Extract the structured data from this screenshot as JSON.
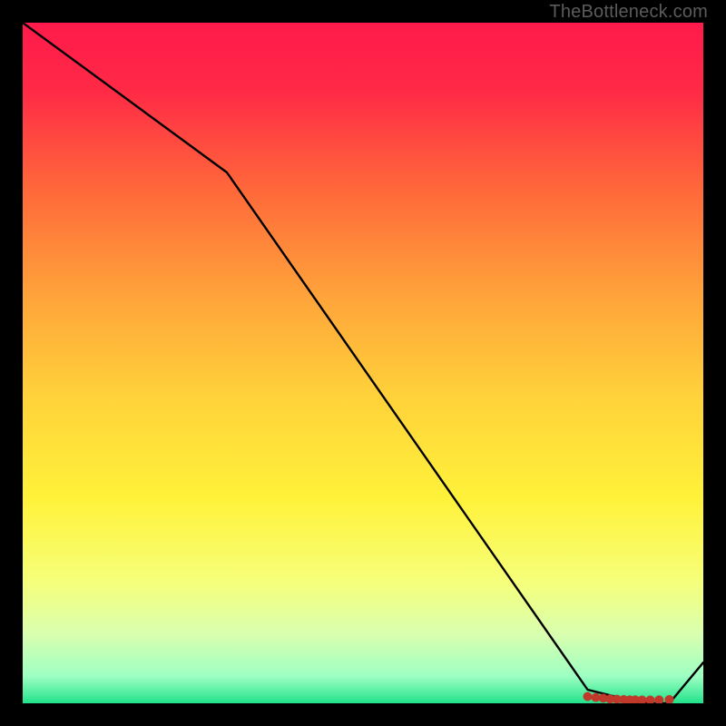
{
  "watermark": "TheBottleneck.com",
  "chart_data": {
    "type": "line",
    "title": "",
    "xlabel": "",
    "ylabel": "",
    "xlim": [
      0,
      100
    ],
    "ylim": [
      0,
      100
    ],
    "grid": false,
    "legend": false,
    "annotations": [],
    "gradient_stops": [
      {
        "offset": 0.0,
        "color": "#ff1a4b"
      },
      {
        "offset": 0.1,
        "color": "#ff2a46"
      },
      {
        "offset": 0.25,
        "color": "#ff6a3a"
      },
      {
        "offset": 0.4,
        "color": "#ffa33a"
      },
      {
        "offset": 0.55,
        "color": "#ffd23a"
      },
      {
        "offset": 0.7,
        "color": "#fff23a"
      },
      {
        "offset": 0.82,
        "color": "#f6ff7a"
      },
      {
        "offset": 0.9,
        "color": "#d8ffb0"
      },
      {
        "offset": 0.96,
        "color": "#9effc3"
      },
      {
        "offset": 1.0,
        "color": "#22e28a"
      }
    ],
    "series": [
      {
        "name": "curve",
        "color": "#000000",
        "x": [
          0,
          30,
          83,
          91,
          95,
          100
        ],
        "y": [
          100,
          78,
          2,
          0,
          0,
          6
        ]
      }
    ],
    "markers": {
      "name": "bottom-cluster",
      "color": "#c0392b",
      "size": 5,
      "x": [
        83.0,
        84.2,
        85.3,
        86.3,
        87.3,
        88.3,
        89.2,
        90.0,
        91.0,
        92.2,
        93.5,
        95.0
      ],
      "y": [
        1.0,
        0.85,
        0.75,
        0.65,
        0.6,
        0.55,
        0.5,
        0.5,
        0.48,
        0.48,
        0.5,
        0.55
      ]
    }
  }
}
